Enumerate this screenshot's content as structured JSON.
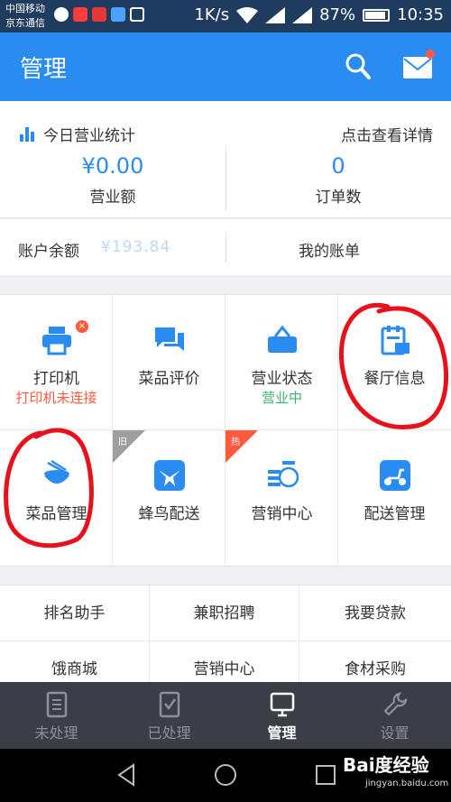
{
  "status_bar": {
    "carrier_line1": "中国移动",
    "carrier_line2": "京东通信",
    "speed": "1K/s",
    "battery": "87%",
    "time": "10:35"
  },
  "header": {
    "title": "管理"
  },
  "stats": {
    "title": "今日营业统计",
    "detail_link": "点击查看详情",
    "revenue_value": "¥0.00",
    "revenue_label": "营业额",
    "orders_value": "0",
    "orders_label": "订单数"
  },
  "account": {
    "balance_label": "账户余额",
    "balance_value": "¥193.84",
    "my_bill_link": "我的账单"
  },
  "grid": {
    "items": [
      {
        "label": "打印机",
        "sub": "打印机未连接",
        "sub_color": "#ff5a3c"
      },
      {
        "label": "菜品评价"
      },
      {
        "label": "营业状态",
        "sub": "营业中",
        "sub_color": "#3cb371"
      },
      {
        "label": "餐厅信息"
      },
      {
        "label": "菜品管理"
      },
      {
        "label": "蜂鸟配送",
        "corner": "旧"
      },
      {
        "label": "营销中心",
        "corner": "热"
      },
      {
        "label": "配送管理"
      }
    ]
  },
  "links": {
    "items": [
      "排名助手",
      "兼职招聘",
      "我要贷款",
      "饿商城",
      "营销中心",
      "食材采购"
    ]
  },
  "tabbar": {
    "tabs": [
      {
        "label": "未处理"
      },
      {
        "label": "已处理"
      },
      {
        "label": "管理"
      },
      {
        "label": "设置"
      }
    ],
    "active_tab": "管理"
  },
  "watermark": {
    "brand": "Bai度经验",
    "url": "jingyan.baidu.com"
  },
  "colors": {
    "primary": "#2a8cf0",
    "status_bar": "#1f3b5e",
    "tabbar": "#3b3f45",
    "alert": "#ff5a3c",
    "success": "#3cb371",
    "annotation": "#e8101a"
  }
}
